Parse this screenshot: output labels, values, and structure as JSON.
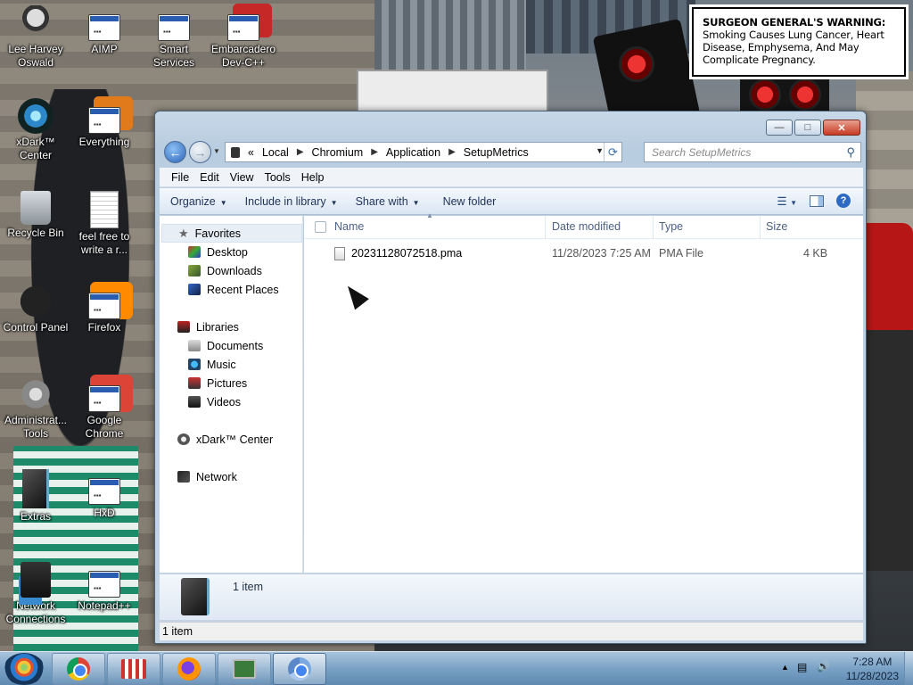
{
  "wallpaper": {
    "warning_bold": "SURGEON GENERAL'S WARNING:",
    "warning_text": "Smoking Causes Lung Cancer, Heart Disease, Emphysema, And May Complicate Pregnancy."
  },
  "desktop_icons": [
    {
      "label_line1": "Lee Harvey",
      "label_line2": "Oswald",
      "icon": "person-icon"
    },
    {
      "label_line1": "AIMP",
      "label_line2": "",
      "icon": "app-icon"
    },
    {
      "label_line1": "Smart",
      "label_line2": "Services",
      "icon": "app-icon"
    },
    {
      "label_line1": "Embarcadero",
      "label_line2": "Dev-C++",
      "icon": "app-icon"
    },
    {
      "label_line1": "xDark™",
      "label_line2": "Center",
      "icon": "xdark-icon"
    },
    {
      "label_line1": "Everything",
      "label_line2": "",
      "icon": "app-icon"
    },
    {
      "label_line1": "Recycle Bin",
      "label_line2": "",
      "icon": "recycle-bin-icon"
    },
    {
      "label_line1": "feel free to",
      "label_line2": "write a r...",
      "icon": "document-icon"
    },
    {
      "label_line1": "Control Panel",
      "label_line2": "",
      "icon": "control-panel-icon"
    },
    {
      "label_line1": "Firefox",
      "label_line2": "",
      "icon": "app-icon"
    },
    {
      "label_line1": "Administrat...",
      "label_line2": "Tools",
      "icon": "admin-tools-icon"
    },
    {
      "label_line1": "Google",
      "label_line2": "Chrome",
      "icon": "app-icon"
    },
    {
      "label_line1": "Extras",
      "label_line2": "",
      "icon": "folder-icon"
    },
    {
      "label_line1": "HxD",
      "label_line2": "",
      "icon": "app-icon"
    },
    {
      "label_line1": "Network",
      "label_line2": "Connections",
      "icon": "network-icon"
    },
    {
      "label_line1": "Notepad++",
      "label_line2": "",
      "icon": "app-icon"
    }
  ],
  "explorer": {
    "address": {
      "overflow": "«",
      "crumbs": [
        "Local",
        "Chromium",
        "Application",
        "SetupMetrics"
      ]
    },
    "search_placeholder": "Search SetupMetrics",
    "menu": [
      "File",
      "Edit",
      "View",
      "Tools",
      "Help"
    ],
    "toolbar": {
      "organize": "Organize",
      "include": "Include in library",
      "share": "Share with",
      "new_folder": "New folder"
    },
    "nav": {
      "favorites": "Favorites",
      "desktop": "Desktop",
      "downloads": "Downloads",
      "recent": "Recent Places",
      "libraries": "Libraries",
      "documents": "Documents",
      "music": "Music",
      "pictures": "Pictures",
      "videos": "Videos",
      "xdark": "xDark™ Center",
      "network": "Network"
    },
    "columns": {
      "name": "Name",
      "date": "Date modified",
      "type": "Type",
      "size": "Size"
    },
    "files": [
      {
        "name": "20231128072518.pma",
        "date": "11/28/2023 7:25 AM",
        "type": "PMA File",
        "size": "4 KB"
      }
    ],
    "details_count": "1 item",
    "status": "1 item"
  },
  "taskbar": {
    "time": "7:28 AM",
    "date": "11/28/2023"
  }
}
